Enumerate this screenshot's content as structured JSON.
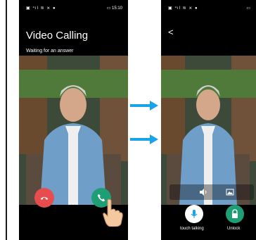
{
  "left_screen": {
    "status_left": "▣ ⁴ıl ≋ ⨯ ●",
    "status_right": "▭ 15:10",
    "title": "Video Calling",
    "subtitle": "Waiting for an answer"
  },
  "right_screen": {
    "status_left": "▣ ⁴ıl ≋ ⨯ ●",
    "status_right": "▭",
    "back_symbol": "<",
    "talk_label": "touch talking",
    "unlock_label": "Unlock"
  },
  "colors": {
    "decline": "#e84d4d",
    "accent": "#1e9e74",
    "arrow": "#1aa3e6"
  },
  "icons": {
    "decline": "phone-hangup-icon",
    "accept": "phone-answer-icon",
    "speaker": "speaker-icon",
    "snapshot": "image-icon",
    "mic": "microphone-icon",
    "lock": "lock-icon"
  }
}
